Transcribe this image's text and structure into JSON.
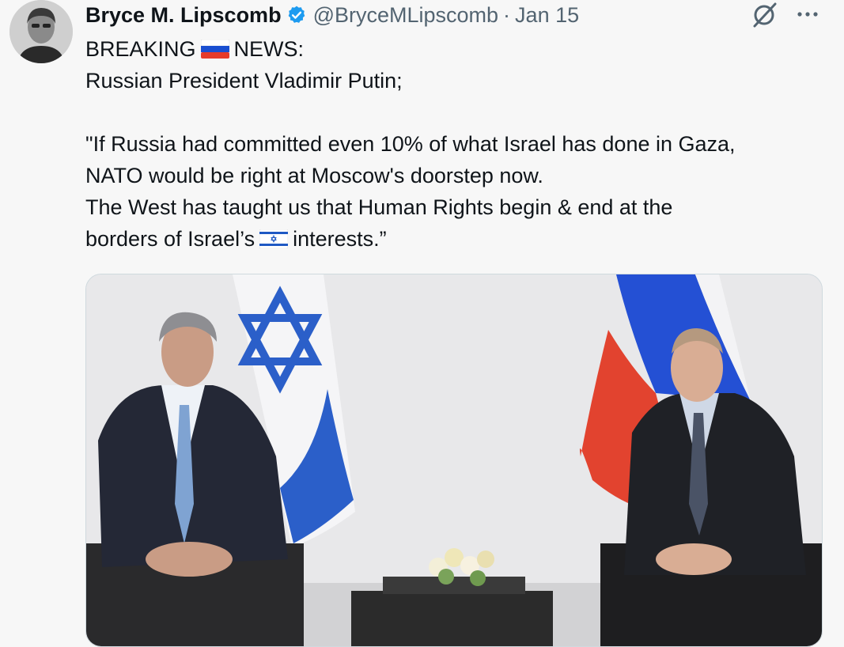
{
  "tweet": {
    "author_name": "Bryce M. Lipscomb",
    "handle": "@BryceMLipscomb",
    "separator": "·",
    "date": "Jan 15",
    "lines": [
      {
        "before": "BREAKING",
        "flag": "russia-flag",
        "after": "NEWS:"
      },
      {
        "text": "Russian President Vladimir Putin;"
      },
      {
        "text": ""
      },
      {
        "text": "\"If Russia had committed even 10% of what Israel has done in Gaza,"
      },
      {
        "text": "NATO would be right at Moscow's doorstep now."
      },
      {
        "text": "The West has taught us that Human Rights begin & end at the"
      },
      {
        "before": "borders of Israel’s",
        "flag": "israel-flag",
        "after": "interests.”"
      }
    ]
  },
  "icons": {
    "verified": "verified-badge-icon",
    "grok": "grok-icon",
    "more": "more-options-icon"
  },
  "colors": {
    "verified_blue": "#1d9bf0",
    "text": "#0f1419",
    "secondary_text": "#536471",
    "israel_blue": "#1f59c4",
    "russia_blue": "#1a4fd1",
    "russia_red": "#e63b2a"
  }
}
